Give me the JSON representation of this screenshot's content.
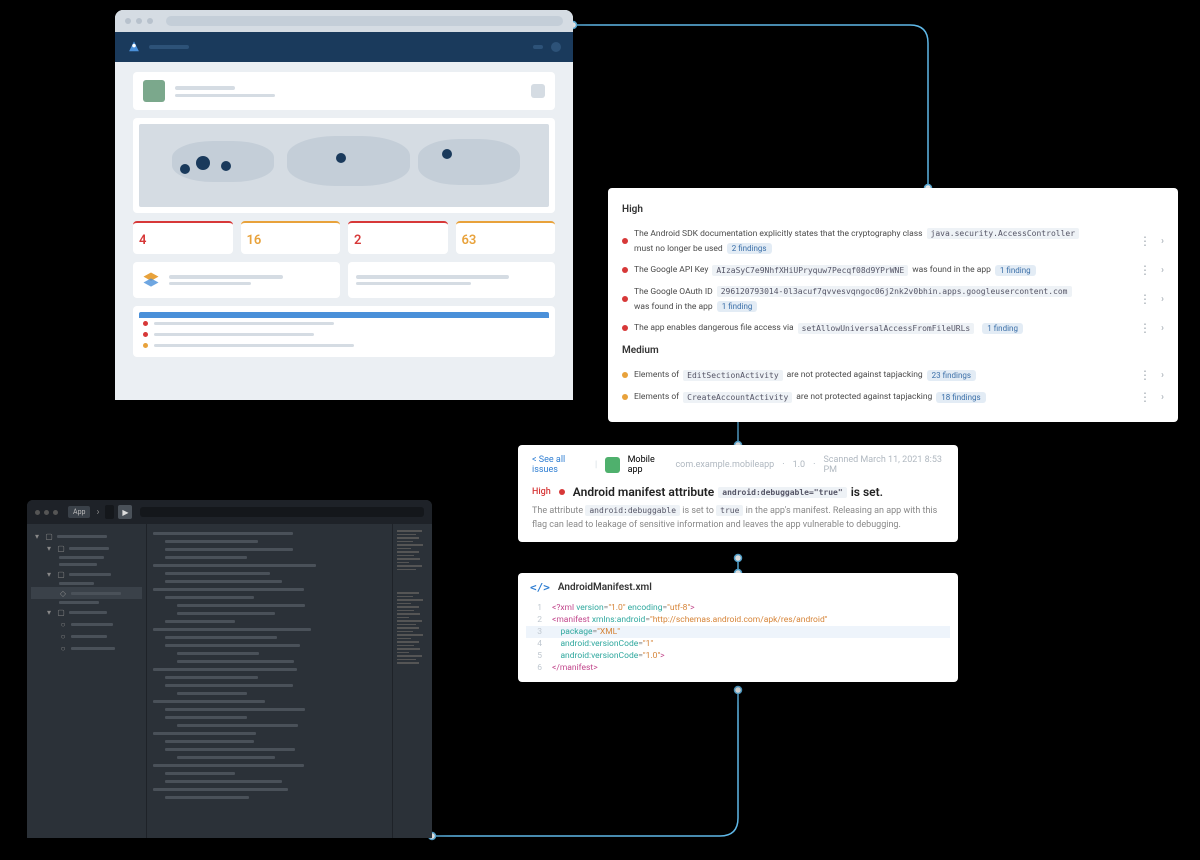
{
  "dashboard": {
    "stats": [
      {
        "value": "4",
        "color": "#d73838"
      },
      {
        "value": "16",
        "color": "#e8a23b"
      },
      {
        "value": "2",
        "color": "#d73838"
      },
      {
        "value": "63",
        "color": "#e8a23b"
      }
    ]
  },
  "findings": {
    "severity_high": "High",
    "severity_medium": "Medium",
    "high": [
      {
        "pre": "The Android SDK documentation explicitly states that the cryptography class",
        "code": "java.security.AccessController",
        "post": "must no longer be used",
        "badge": "2 findings"
      },
      {
        "pre": "The Google API Key",
        "code": "AIzaSyC7e9NhfXHiUPryquw7Pecqf08d9YPrWNE",
        "post": "was found in the app",
        "badge": "1 finding"
      },
      {
        "pre": "The Google OAuth ID",
        "code": "296120793014-0l3acuf7qvvesvqngoc06j2nk2v0bhin.apps.googleusercontent.com",
        "post": "was found in the app",
        "badge": "1 finding"
      },
      {
        "pre": "The app enables dangerous file access via",
        "code": "setAllowUniversalAccessFromFileURLs",
        "post": "",
        "badge": "1 finding"
      }
    ],
    "medium": [
      {
        "pre": "Elements of",
        "code": "EditSectionActivity",
        "post": "are not protected against tapjacking",
        "badge": "23 findings"
      },
      {
        "pre": "Elements of",
        "code": "CreateAccountActivity",
        "post": "are not protected against tapjacking",
        "badge": "18 findings"
      }
    ]
  },
  "issue": {
    "back": "< See all issues",
    "app_name": "Mobile app",
    "package": "com.example.mobileapp",
    "version": "1.0",
    "scanned": "Scanned March 11, 2021 8:53 PM",
    "severity": "High",
    "title_pre": "Android manifest attribute",
    "title_code": "android:debuggable=\"true\"",
    "title_post": "is set.",
    "desc_1": "The attribute",
    "desc_code1": "android:debuggable",
    "desc_2": "is set to",
    "desc_code2": "true",
    "desc_3": "in the app's manifest. Releasing an app with this flag can lead to leakage of sensitive information and leaves the app vulnerable to debugging."
  },
  "code": {
    "filename": "AndroidManifest.xml",
    "lines": [
      {
        "n": "1",
        "pre": "<?xml ",
        "attr": "version",
        "eq": "=",
        "str": "\"1.0\"",
        "attr2": " encoding",
        "str2": "=\"utf-8\"",
        "suf": ">"
      },
      {
        "n": "2",
        "pre": "<manifest ",
        "attr": "xmlns:android",
        "eq": "=",
        "str": "\"http://schemas.android.com/apk/res/android\"",
        "suf": ""
      },
      {
        "n": "3",
        "hl": true,
        "pre": "    ",
        "attr": "package",
        "eq": "=",
        "str": "\"XML\"",
        "suf": ""
      },
      {
        "n": "4",
        "pre": "    ",
        "attr": "android:versionCode",
        "eq": "=",
        "str": "\"1\"",
        "suf": ""
      },
      {
        "n": "5",
        "pre": "    ",
        "attr": "android:versionCode",
        "eq": "=",
        "str": "\"1.0\"",
        "suf": ">"
      },
      {
        "n": "6",
        "pre": "</manifest>",
        "attr": "",
        "eq": "",
        "str": "",
        "suf": ""
      }
    ]
  },
  "ide": {
    "breadcrumb": "App"
  }
}
